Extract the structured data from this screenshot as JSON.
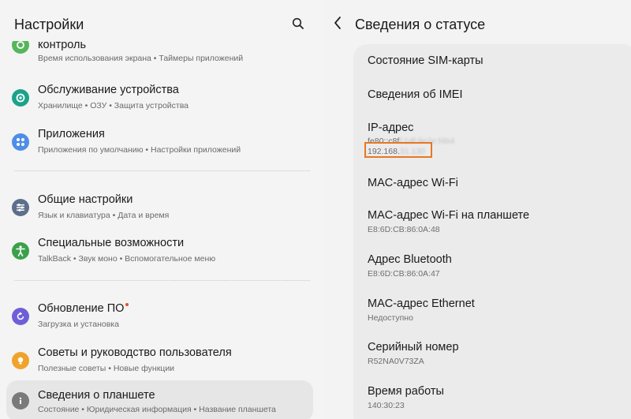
{
  "left": {
    "title": "Настройки",
    "items": [
      {
        "title": "контроль",
        "subtitle": "Время использования экрана • Таймеры приложений",
        "icon": "digital-wellbeing-icon",
        "color": "#55b65a"
      },
      {
        "title": "Обслуживание устройства",
        "subtitle": "Хранилище • ОЗУ • Защита устройства",
        "icon": "device-care-icon",
        "color": "#1aa38a"
      },
      {
        "title": "Приложения",
        "subtitle": "Приложения по умолчанию • Настройки приложений",
        "icon": "apps-icon",
        "color": "#4d8ee8"
      },
      {
        "title": "Общие настройки",
        "subtitle": "Язык и клавиатура • Дата и время",
        "icon": "general-settings-icon",
        "color": "#5d6f8a"
      },
      {
        "title": "Специальные возможности",
        "subtitle": "TalkBack • Звук моно • Вспомогательное меню",
        "icon": "accessibility-icon",
        "color": "#3aa14a"
      },
      {
        "title": "Обновление ПО",
        "subtitle": "Загрузка и установка",
        "icon": "software-update-icon",
        "color": "#6e5fd8"
      },
      {
        "title": "Советы и руководство пользователя",
        "subtitle": "Полезные советы • Новые функции",
        "icon": "tips-icon",
        "color": "#f0a32c"
      },
      {
        "title": "Сведения о планшете",
        "subtitle": "Состояние • Юридическая информация • Название планшета",
        "icon": "info-icon",
        "color": "#7a7a7a"
      }
    ]
  },
  "right": {
    "title": "Сведения о статусе",
    "rows": [
      {
        "title": "Состояние SIM-карты"
      },
      {
        "title": "Сведения об IMEI"
      },
      {
        "title": "IP-адрес",
        "line1_visible": "fe80::c8f",
        "line1_blurred": "f:1df:9e2e:f4b4",
        "line2_visible": "192.168.",
        "line2_blurred": "31.130"
      },
      {
        "title": "MAC-адрес Wi-Fi"
      },
      {
        "title": "MAC-адрес Wi-Fi на планшете",
        "subtitle": "E8:6D:CB:86:0A:48"
      },
      {
        "title": "Адрес Bluetooth",
        "subtitle": "E8:6D:CB:86:0A:47"
      },
      {
        "title": "MAC-адрес Ethernet",
        "subtitle": "Недоступно"
      },
      {
        "title": "Серийный номер",
        "subtitle": "R52NA0V73ZA"
      },
      {
        "title": "Время работы",
        "subtitle": "140:30:23"
      }
    ]
  },
  "colors": {
    "highlight": "#e87722",
    "badge": "#e8502a"
  }
}
